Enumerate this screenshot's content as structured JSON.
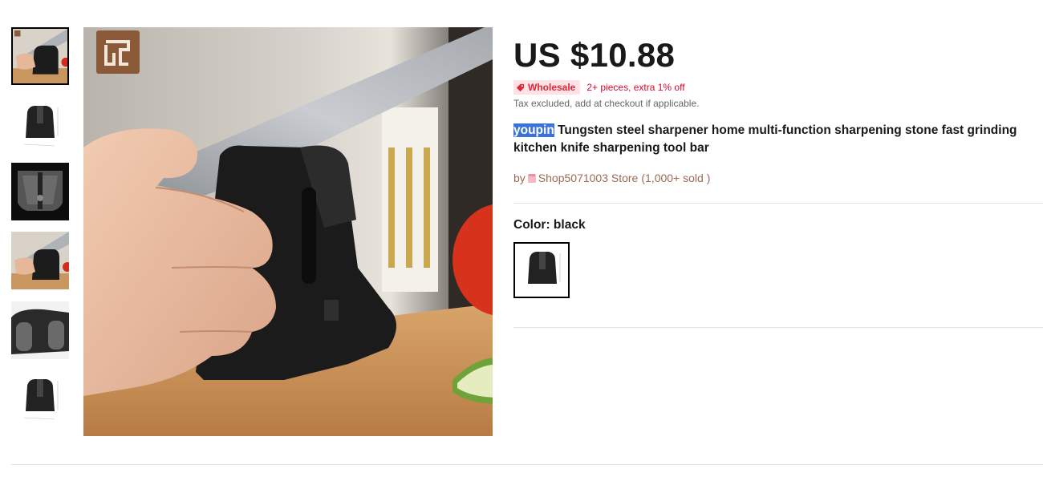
{
  "product": {
    "price": "US $10.88",
    "wholesale_badge": "Wholesale",
    "wholesale_text": "2+ pieces, extra 1% off",
    "tax_note": "Tax excluded, add at checkout if applicable.",
    "title_brand": "youpin",
    "title_rest": " Tungsten steel sharpener home multi-function sharpening stone fast grinding kitchen knife sharpening tool bar",
    "by_prefix": "by",
    "store_name": "Shop5071003 Store",
    "sold": "(1,000+ sold )",
    "color_label": "Color: black"
  },
  "gallery": {
    "thumbnails": [
      "knife-in-sharpener",
      "sharpener-front",
      "sharpener-dark-topview",
      "knife-in-sharpener",
      "sharpener-base-closeup",
      "sharpener-front"
    ],
    "selected_index": 0
  },
  "colors": {
    "accent": "#e0263b",
    "brand_highlight": "#3a72d8",
    "store_text": "#9a6b55"
  }
}
